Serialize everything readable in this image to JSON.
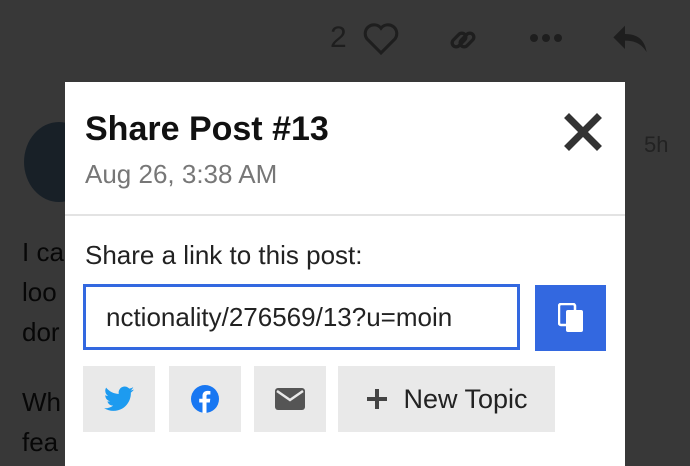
{
  "background": {
    "like_count": "2",
    "timestamp": "5h"
  },
  "modal": {
    "title": "Share Post #13",
    "date": "Aug 26, 3:38 AM",
    "share_label": "Share a link to this post:",
    "link_value": "nctionality/276569/13?u=moin",
    "new_topic_label": "New Topic"
  },
  "colors": {
    "accent": "#3368e0",
    "twitter": "#1d9bf0",
    "facebook": "#1877f2",
    "button_bg": "#e9e9e9"
  }
}
